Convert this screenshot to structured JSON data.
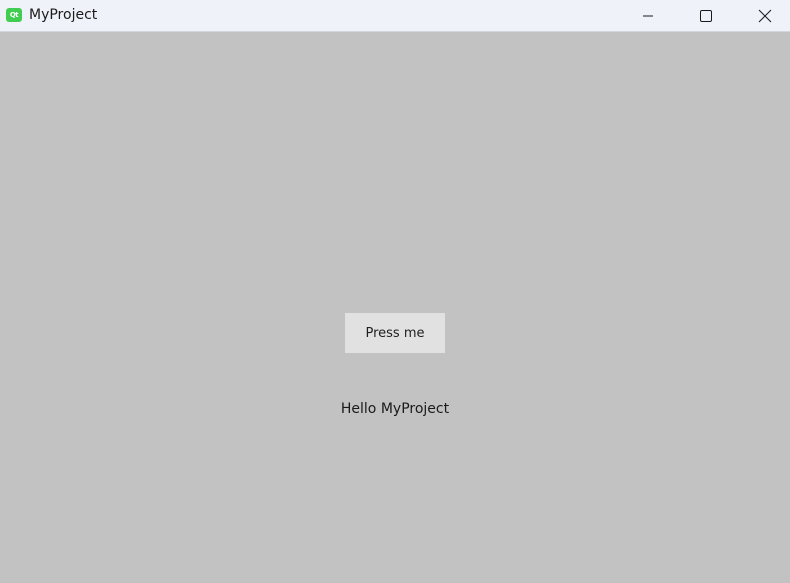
{
  "window": {
    "title": "MyProject",
    "app_icon_glyph": "Qt",
    "app_icon_name": "qt-logo-icon",
    "accent_color": "#41cd52",
    "controls": {
      "minimize_icon": "minimize-icon",
      "maximize_icon": "maximize-icon",
      "close_icon": "close-icon"
    }
  },
  "main": {
    "button_label": "Press me",
    "label_text": "Hello MyProject"
  }
}
